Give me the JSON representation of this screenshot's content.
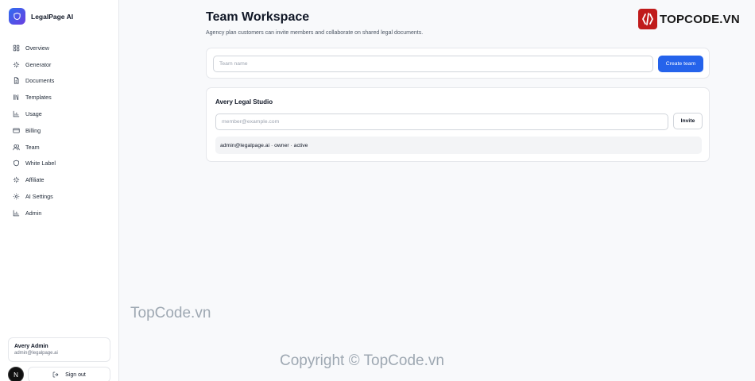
{
  "brand": {
    "name": "LegalPage AI",
    "icon": "shield-icon"
  },
  "sidebar": {
    "items": [
      {
        "label": "Overview",
        "icon": "grid-icon"
      },
      {
        "label": "Generator",
        "icon": "sparkles-icon"
      },
      {
        "label": "Documents",
        "icon": "document-icon"
      },
      {
        "label": "Templates",
        "icon": "library-icon"
      },
      {
        "label": "Usage",
        "icon": "bar-chart-icon"
      },
      {
        "label": "Billing",
        "icon": "credit-card-icon"
      },
      {
        "label": "Team",
        "icon": "users-icon"
      },
      {
        "label": "White Label",
        "icon": "shield-icon"
      },
      {
        "label": "Affiliate",
        "icon": "sparkles-icon"
      },
      {
        "label": "AI Settings",
        "icon": "gear-icon"
      },
      {
        "label": "Admin",
        "icon": "bar-chart-icon"
      }
    ],
    "user": {
      "name": "Avery Admin",
      "email": "admin@legalpage.ai"
    },
    "avatar_letter": "N",
    "signout_label": "Sign out"
  },
  "main": {
    "title": "Team Workspace",
    "subtitle": "Agency plan customers can invite members and collaborate on shared legal documents.",
    "create": {
      "placeholder": "Team name",
      "button": "Create team"
    },
    "team": {
      "name": "Avery Legal Studio",
      "invite_placeholder": "member@example.com",
      "invite_button": "Invite",
      "members": [
        {
          "text": "admin@legalpage.ai · owner · active"
        }
      ]
    }
  },
  "watermark": {
    "logo_text": "TOPCODE.VN",
    "text1": "TopCode.vn",
    "text2": "Copyright © TopCode.vn"
  },
  "colors": {
    "primary": "#2563eb",
    "brand_gradient_start": "#2f6df0",
    "brand_gradient_end": "#6a3fe0",
    "watermark_red": "#c01b1b"
  }
}
